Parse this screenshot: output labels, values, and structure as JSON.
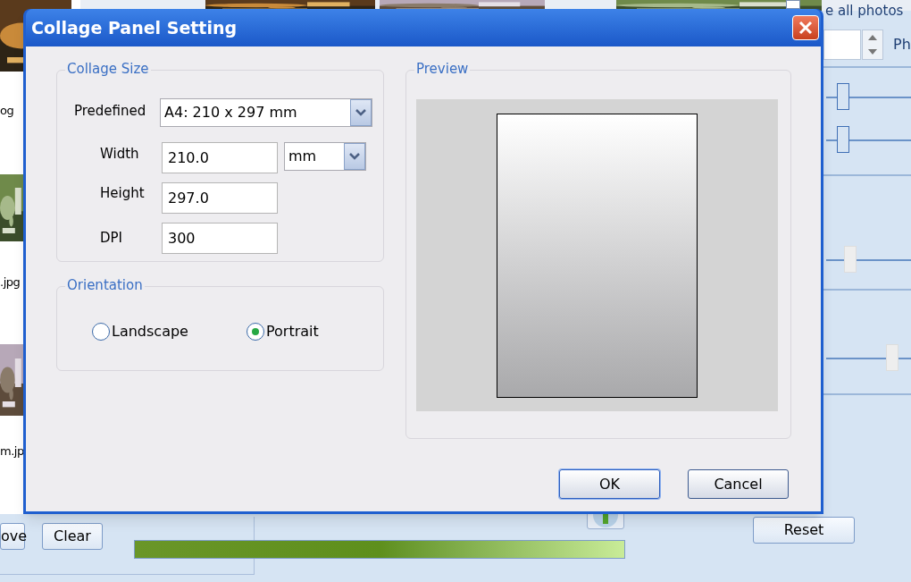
{
  "background": {
    "file_names": [
      "og",
      ".jpg",
      "m.jp"
    ],
    "use_all_photos": {
      "label": "e all photos",
      "checked": false
    },
    "spin_label": "Ph",
    "sliders": [
      {
        "level": 0.2
      },
      {
        "level": 0.2
      },
      {
        "level": 0.28
      },
      {
        "level": 0.78
      }
    ],
    "buttons": [
      "ove",
      "Clear",
      "Reset"
    ],
    "progress": {
      "level": 1
    }
  },
  "dialog": {
    "title": "Collage Panel Setting",
    "collage_size": {
      "title": "Collage Size",
      "predefined_label": "Predefined",
      "predefined_value": "A4: 210 x 297 mm",
      "width_label": "Width",
      "width_value": "210.0",
      "unit_value": "mm",
      "height_label": "Height",
      "height_value": "297.0",
      "dpi_label": "DPI",
      "dpi_value": "300"
    },
    "orientation": {
      "title": "Orientation",
      "options": [
        {
          "label": "Landscape",
          "selected": false
        },
        {
          "label": "Portrait",
          "selected": true
        }
      ]
    },
    "preview": {
      "title": "Preview"
    },
    "buttons": [
      "OK",
      "Cancel"
    ]
  }
}
